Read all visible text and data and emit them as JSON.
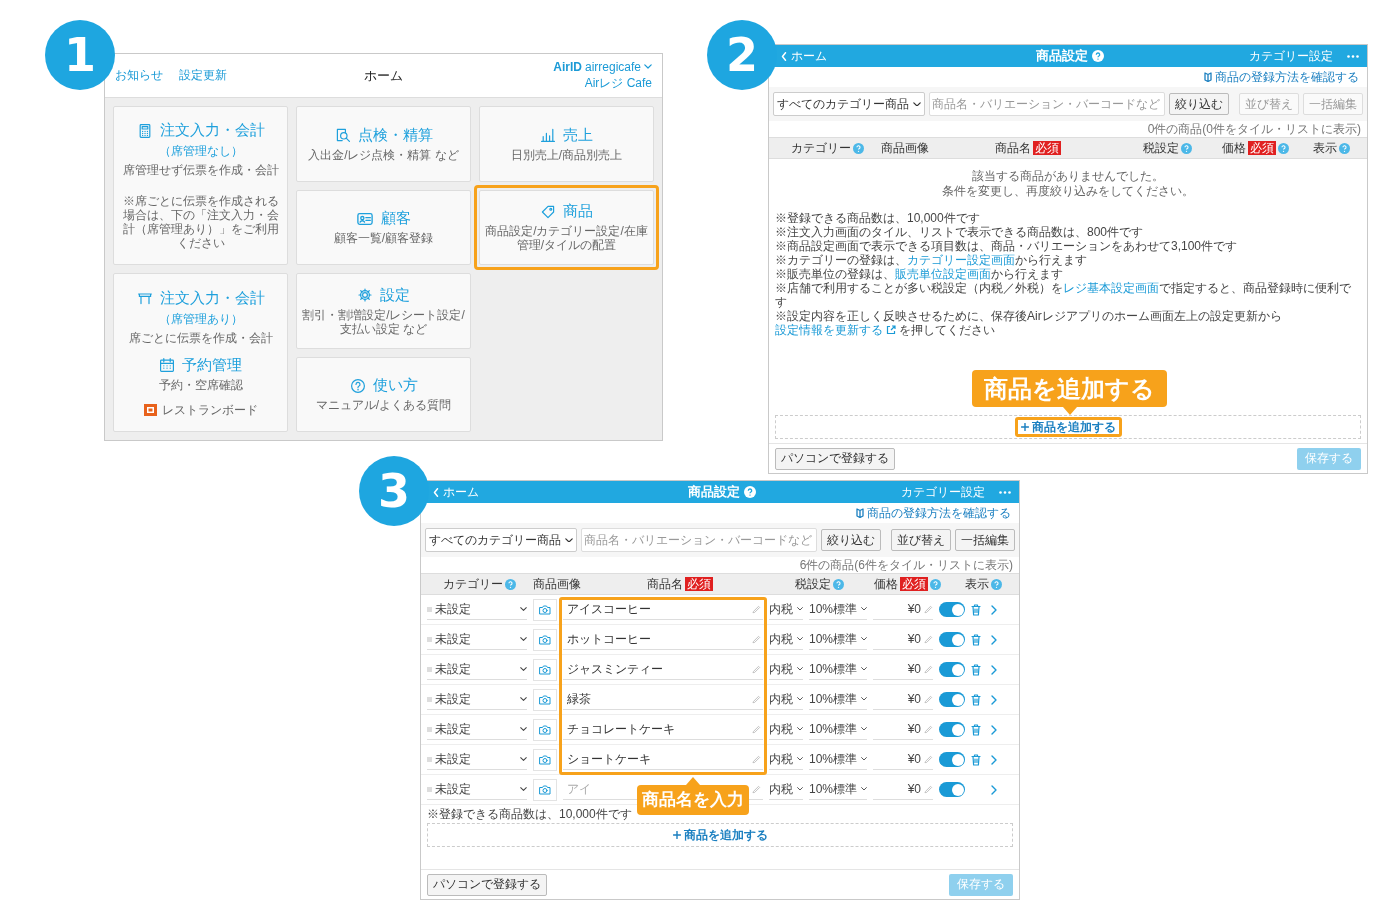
{
  "step_badges": [
    "1",
    "2",
    "3"
  ],
  "home_screen": {
    "header": {
      "links": [
        "お知らせ",
        "設定更新"
      ],
      "title": "ホーム",
      "account": {
        "id_label": "AirID",
        "id": "airregicafe",
        "store": "Airレジ Cafe"
      }
    },
    "tiles": [
      {
        "kind": "order",
        "title": "注文入力・会計",
        "subtitle": "（席管理なし）",
        "description": "席管理せず伝票を作成・会計",
        "note": "※席ごとに伝票を作成される場合は、下の「注文入力・会計（席管理あり）」をご利用ください",
        "highlighted": false
      },
      {
        "kind": "order_table",
        "title": "注文入力・会計",
        "subtitle": "（席管理あり）",
        "description": "席ごとに伝票を作成・会計",
        "reservation": {
          "title": "予約管理",
          "description": "予約・空席確認"
        },
        "board": "レストランボード",
        "highlighted": false
      },
      {
        "kind": "check",
        "title": "点検・精算",
        "description": "入出金/レジ点検・精算 など",
        "highlighted": false
      },
      {
        "kind": "customer",
        "title": "顧客",
        "description": "顧客一覧/顧客登録",
        "highlighted": false
      },
      {
        "kind": "settings",
        "title": "設定",
        "description": "割引・割増設定/レシート設定/支払い設定 など",
        "highlighted": false
      },
      {
        "kind": "help",
        "title": "使い方",
        "description": "マニュアル/よくある質問",
        "highlighted": false
      },
      {
        "kind": "sales",
        "title": "売上",
        "description": "日別売上/商品別売上",
        "highlighted": false
      },
      {
        "kind": "product",
        "title": "商品",
        "description": "商品設定/カテゴリー設定/在庫管理/タイルの配置",
        "highlighted": true
      }
    ]
  },
  "product_screen_empty": {
    "top_bar": {
      "back": "ホーム",
      "title": "商品設定",
      "right_link": "カテゴリー設定"
    },
    "guide_link": "商品の登録方法を確認する",
    "filter": {
      "category": "すべてのカテゴリー商品",
      "search_placeholder": "商品名・バリエーション・バーコードなど",
      "filter_button": "絞り込む"
    },
    "actions": [
      {
        "label": "並び替え",
        "disabled": true
      },
      {
        "label": "一括編集",
        "disabled": true
      }
    ],
    "count": "0件の商品(0件をタイル・リストに表示)",
    "columns": [
      {
        "label": "カテゴリー",
        "help": true
      },
      {
        "label": "商品画像",
        "help": false
      },
      {
        "label": "商品名",
        "badge": "必須",
        "help": false
      },
      {
        "label": "税設定",
        "help": true
      },
      {
        "label": "価格",
        "badge": "必須",
        "help": true
      },
      {
        "label": "表示",
        "help": true
      }
    ],
    "empty_message": [
      "該当する商品がありませんでした。",
      "条件を変更し、再度絞り込みをしてください。"
    ],
    "notes": [
      [
        {
          "text": "※登録できる商品数は、10,000件です"
        }
      ],
      [
        {
          "text": "※注文入力画面のタイル、リストで表示できる商品数は、800件です"
        }
      ],
      [
        {
          "text": "※商品設定画面で表示できる項目数は、商品・バリエーションをあわせて3,100件です"
        }
      ],
      [
        {
          "text": "※カテゴリーの登録は、"
        },
        {
          "text": "カテゴリー設定画面",
          "link": true
        },
        {
          "text": "から行えます"
        }
      ],
      [
        {
          "text": "※販売単位の登録は、"
        },
        {
          "text": "販売単位設定画面",
          "link": true
        },
        {
          "text": "から行えます"
        }
      ],
      [
        {
          "text": "※店舗で利用することが多い税設定（内税／外税）を"
        },
        {
          "text": "レジ基本設定画面",
          "link": true
        },
        {
          "text": "で指定すると、商品登録時に便利です"
        }
      ],
      [
        {
          "text": "※設定内容を正しく反映させるために、保存後Airレジアプリのホーム画面左上の設定更新から"
        },
        {
          "text": "設定情報を更新する",
          "link": true,
          "external": true
        },
        {
          "text": "を押してください"
        }
      ]
    ],
    "add_button": {
      "label": "商品を追加する",
      "highlighted": true
    },
    "pc_button": "パソコンで登録する",
    "save_button": {
      "label": "保存する",
      "disabled": true
    },
    "callout": "商品を追加する"
  },
  "product_screen_filled": {
    "top_bar": {
      "back": "ホーム",
      "title": "商品設定",
      "right_link": "カテゴリー設定"
    },
    "guide_link": "商品の登録方法を確認する",
    "filter": {
      "category": "すべてのカテゴリー商品",
      "search_placeholder": "商品名・バリエーション・バーコードなど",
      "filter_button": "絞り込む"
    },
    "actions": [
      {
        "label": "並び替え",
        "disabled": false
      },
      {
        "label": "一括編集",
        "disabled": false
      }
    ],
    "count": "6件の商品(6件をタイル・リストに表示)",
    "columns": [
      {
        "label": "カテゴリー",
        "help": true
      },
      {
        "label": "商品画像",
        "help": false
      },
      {
        "label": "商品名",
        "badge": "必須",
        "help": false
      },
      {
        "label": "税設定",
        "help": true
      },
      {
        "label": "価格",
        "badge": "必須",
        "help": true
      },
      {
        "label": "表示",
        "help": true
      }
    ],
    "rows": [
      {
        "category": "未設定",
        "name": "アイスコーヒー",
        "tax_mode": "内税",
        "tax_rate": "10%標準",
        "price": "¥0",
        "visible": true,
        "deletable": true
      },
      {
        "category": "未設定",
        "name": "ホットコーヒー",
        "tax_mode": "内税",
        "tax_rate": "10%標準",
        "price": "¥0",
        "visible": true,
        "deletable": true
      },
      {
        "category": "未設定",
        "name": "ジャスミンティー",
        "tax_mode": "内税",
        "tax_rate": "10%標準",
        "price": "¥0",
        "visible": true,
        "deletable": true
      },
      {
        "category": "未設定",
        "name": "緑茶",
        "tax_mode": "内税",
        "tax_rate": "10%標準",
        "price": "¥0",
        "visible": true,
        "deletable": true
      },
      {
        "category": "未設定",
        "name": "チョコレートケーキ",
        "tax_mode": "内税",
        "tax_rate": "10%標準",
        "price": "¥0",
        "visible": true,
        "deletable": true
      },
      {
        "category": "未設定",
        "name": "ショートケーキ",
        "tax_mode": "内税",
        "tax_rate": "10%標準",
        "price": "¥0",
        "visible": true,
        "deletable": true
      },
      {
        "category": "未設定",
        "name_placeholder": "アイ",
        "tax_mode": "内税",
        "tax_rate": "10%標準",
        "price": "¥0",
        "visible": true,
        "deletable": false
      }
    ],
    "notes": [
      [
        {
          "text": "※登録できる商品数は、10,000件です"
        }
      ]
    ],
    "add_button": {
      "label": "商品を追加する",
      "highlighted": false
    },
    "pc_button": "パソコンで登録する",
    "save_button": {
      "label": "保存する",
      "disabled": true
    },
    "callout": "商品名を入力"
  }
}
